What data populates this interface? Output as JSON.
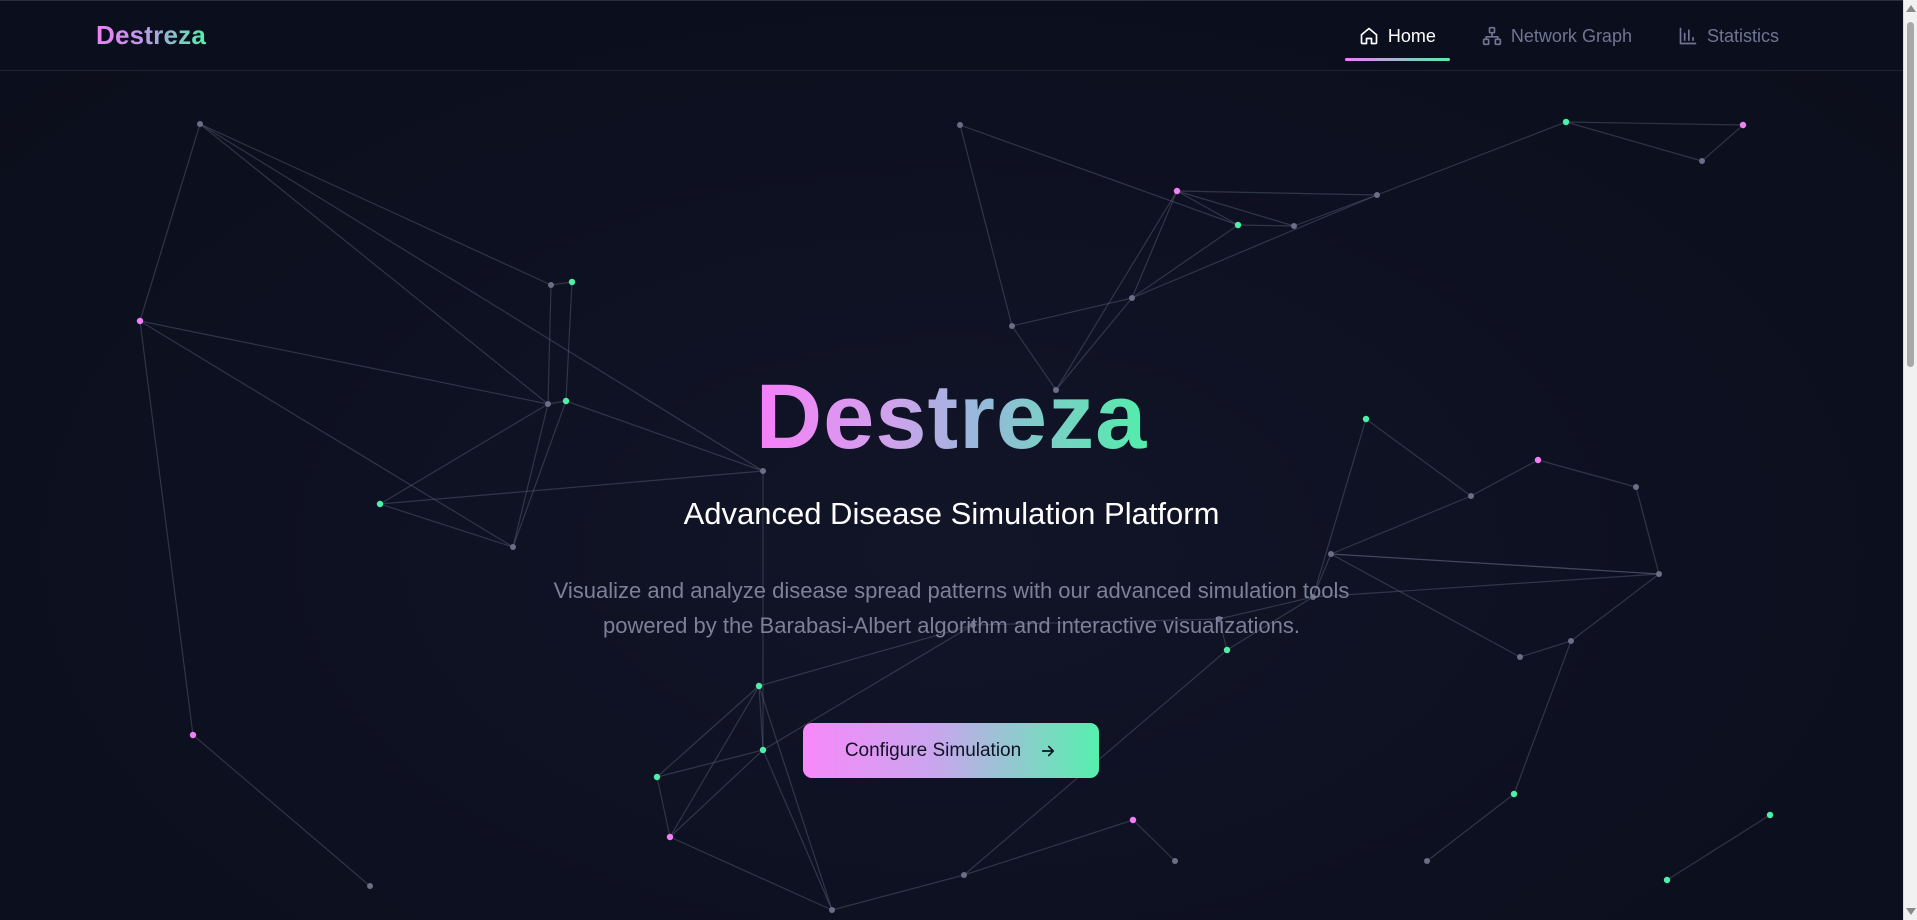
{
  "brand": {
    "name": "Destreza"
  },
  "nav": {
    "items": [
      {
        "label": "Home",
        "icon": "home-icon",
        "active": true
      },
      {
        "label": "Network Graph",
        "icon": "network-icon",
        "active": false
      },
      {
        "label": "Statistics",
        "icon": "bar-chart-icon",
        "active": false
      }
    ]
  },
  "hero": {
    "title": "Destreza",
    "subtitle": "Advanced Disease Simulation Platform",
    "description": "Visualize and analyze disease spread patterns with our advanced simulation tools powered by the Barabasi-Albert algorithm and interactive visualizations.",
    "cta_label": "Configure Simulation",
    "cta_icon": "arrow-right-icon"
  },
  "colors": {
    "background": "#0c0f1d",
    "accent_pink": "#f27ff6",
    "accent_green": "#52eeaa",
    "muted_text": "#7c8198",
    "node_gray": "#6a6e86"
  }
}
